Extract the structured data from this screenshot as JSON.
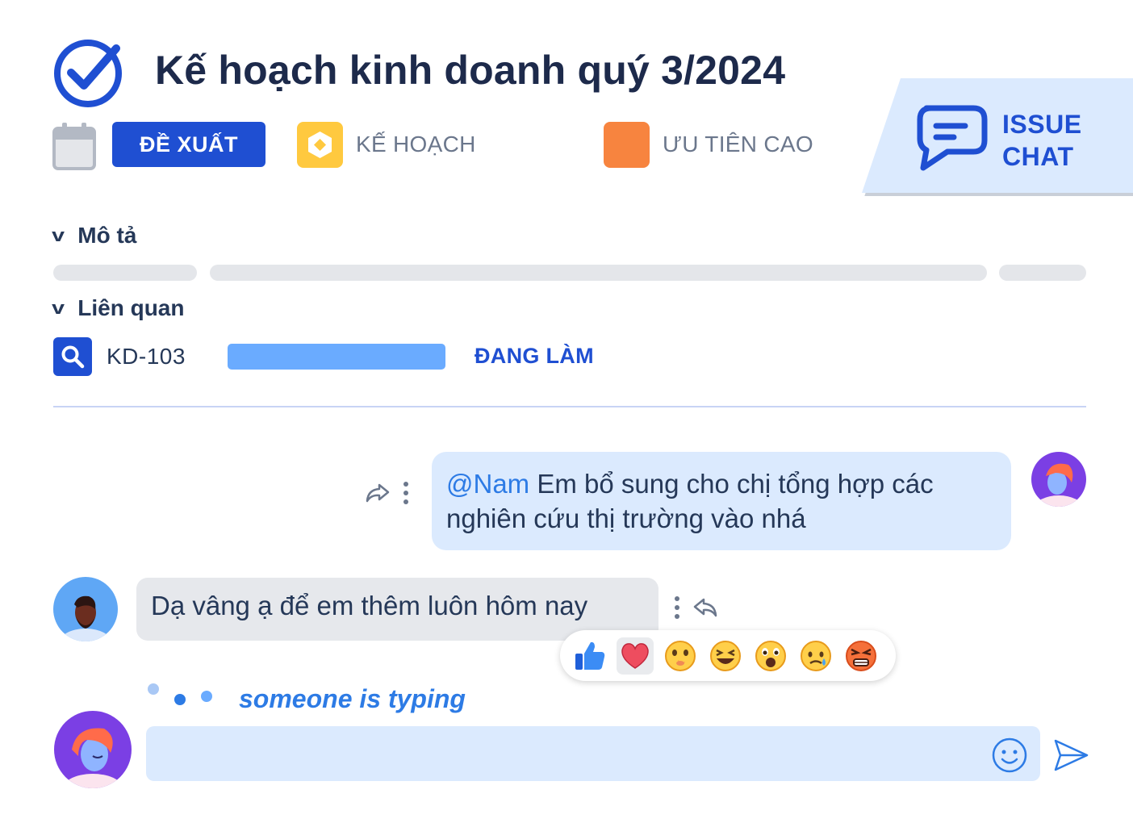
{
  "header": {
    "title": "Kế hoạch kinh doanh quý 3/2024"
  },
  "meta": {
    "status": "ĐỀ XUẤT",
    "type": "KẾ HOẠCH",
    "priority": "ƯU TIÊN CAO"
  },
  "issue_chat": {
    "line1": "ISSUE",
    "line2": "CHAT"
  },
  "sections": {
    "description": "Mô tả",
    "related": "Liên quan"
  },
  "related_issue": {
    "key": "KD-103",
    "status": "ĐANG LÀM"
  },
  "messages": [
    {
      "direction": "out",
      "mention": "@Nam",
      "text": " Em bổ sung cho chị tổng hợp các nghiên cứu thị trường vào nhá"
    },
    {
      "direction": "in",
      "text": "Dạ vâng ạ để em thêm luôn hôm nay"
    }
  ],
  "reactions": [
    "👍",
    "❤️",
    "🤭",
    "😆",
    "😮",
    "😢",
    "😡"
  ],
  "typing": "someone is typing",
  "colors": {
    "primary": "#1f4fd2",
    "bubble_out": "#dbeafe",
    "bubble_in": "#e6e8ec",
    "priority": "#f7843f",
    "plan_icon": "#ffc93f"
  }
}
